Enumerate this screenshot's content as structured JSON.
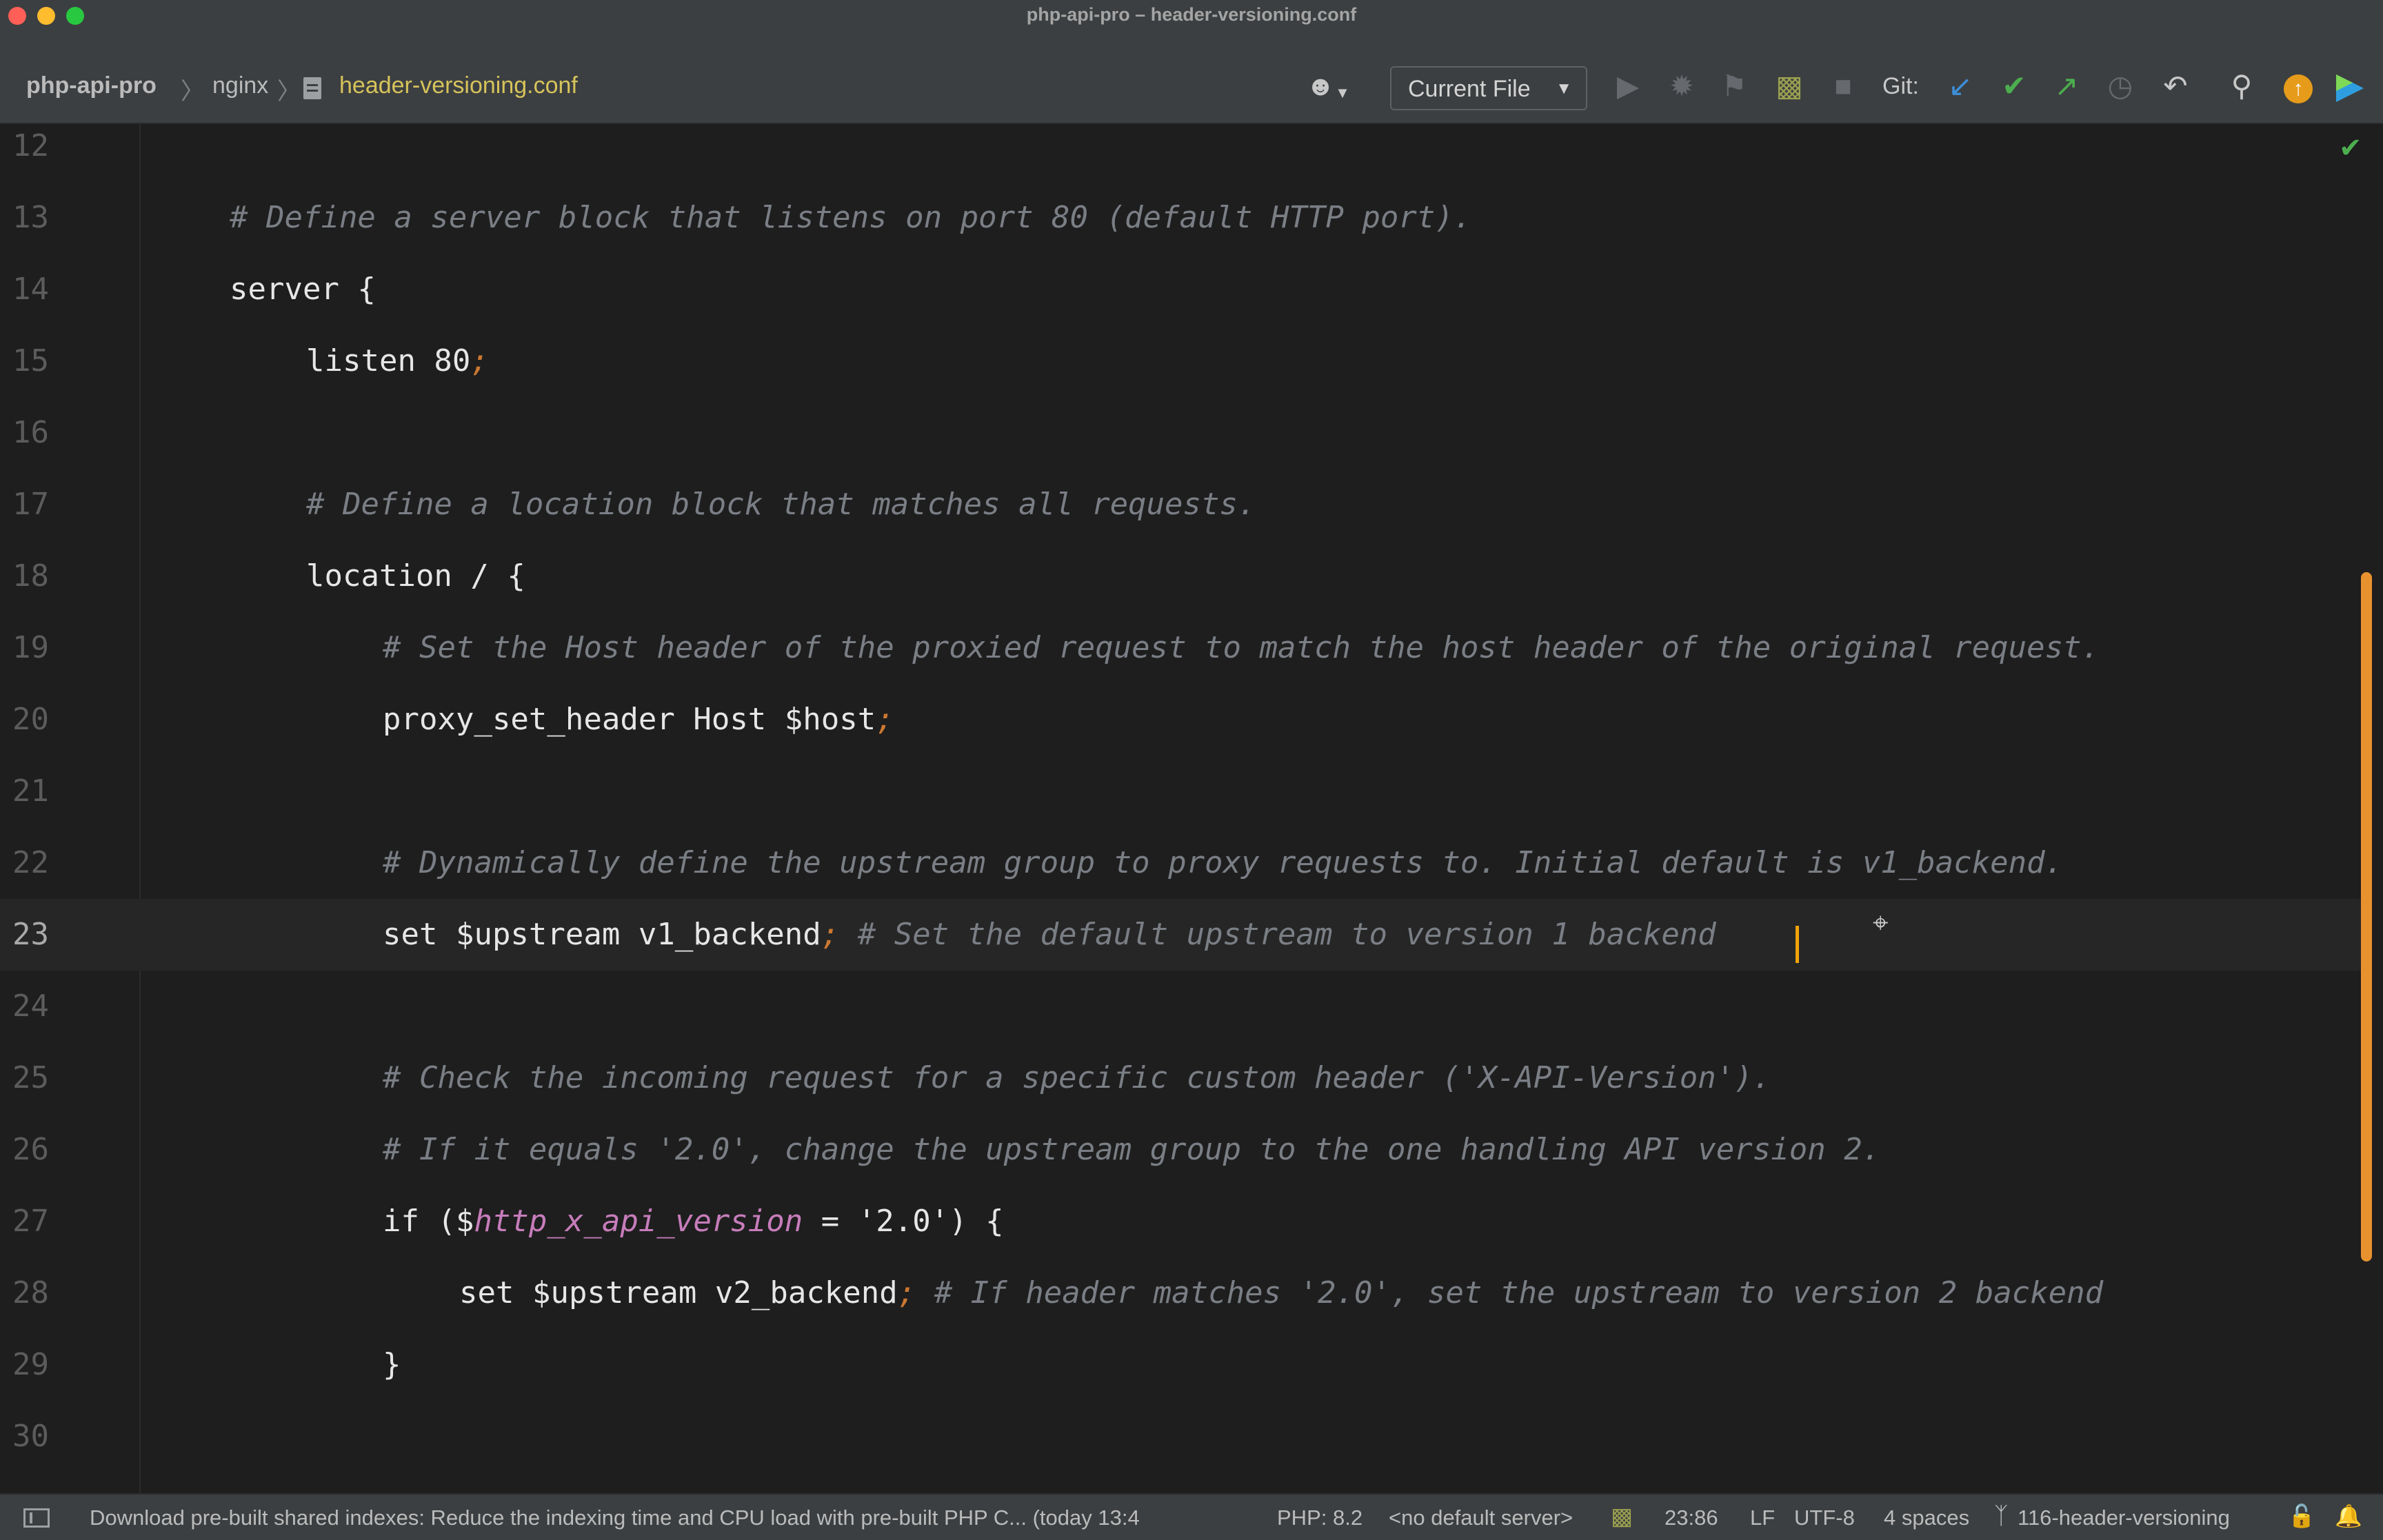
{
  "window": {
    "title": "php-api-pro – header-versioning.conf"
  },
  "navbar": {
    "breadcrumbs": [
      "php-api-pro",
      "nginx",
      "header-versioning.conf"
    ],
    "separator": "〉",
    "run_config": "Current File",
    "git_label": "Git:"
  },
  "editor": {
    "current_line": 23,
    "lines": [
      {
        "n": "12",
        "indent": 0,
        "tokens": []
      },
      {
        "n": "13",
        "indent": 1,
        "tokens": [
          {
            "t": "# Define a server block that listens on port 80 (default HTTP port).",
            "c": "cmt"
          }
        ]
      },
      {
        "n": "14",
        "indent": 1,
        "tokens": [
          {
            "t": "server {",
            "c": "kw"
          }
        ]
      },
      {
        "n": "15",
        "indent": 2,
        "tokens": [
          {
            "t": "listen 80",
            "c": "kw"
          },
          {
            "t": ";",
            "c": "punct"
          }
        ]
      },
      {
        "n": "16",
        "indent": 0,
        "tokens": []
      },
      {
        "n": "17",
        "indent": 2,
        "tokens": [
          {
            "t": "# Define a location block that matches all requests.",
            "c": "cmt"
          }
        ]
      },
      {
        "n": "18",
        "indent": 2,
        "tokens": [
          {
            "t": "location / {",
            "c": "kw"
          }
        ]
      },
      {
        "n": "19",
        "indent": 3,
        "tokens": [
          {
            "t": "# Set the Host header of the proxied request to match the host header of the original request.",
            "c": "cmt"
          }
        ]
      },
      {
        "n": "20",
        "indent": 3,
        "tokens": [
          {
            "t": "proxy_set_header Host $host",
            "c": "kw"
          },
          {
            "t": ";",
            "c": "punct"
          }
        ]
      },
      {
        "n": "21",
        "indent": 0,
        "tokens": []
      },
      {
        "n": "22",
        "indent": 3,
        "tokens": [
          {
            "t": "# Dynamically define the upstream group to proxy requests to. Initial default is v1_backend.",
            "c": "cmt"
          }
        ]
      },
      {
        "n": "23",
        "indent": 3,
        "tokens": [
          {
            "t": "set $upstream v1_backend",
            "c": "kw"
          },
          {
            "t": ";",
            "c": "punct"
          },
          {
            "t": " # Set the default upstream to version 1 backend",
            "c": "cmt"
          }
        ]
      },
      {
        "n": "24",
        "indent": 0,
        "tokens": []
      },
      {
        "n": "25",
        "indent": 3,
        "tokens": [
          {
            "t": "# Check the incoming request for a specific custom header ('X-API-Version').",
            "c": "cmt"
          }
        ]
      },
      {
        "n": "26",
        "indent": 3,
        "tokens": [
          {
            "t": "# If it equals '2.0', change the upstream group to the one handling API version 2.",
            "c": "cmt"
          }
        ]
      },
      {
        "n": "27",
        "indent": 3,
        "tokens": [
          {
            "t": "if ($",
            "c": "kw"
          },
          {
            "t": "http_x_api_version",
            "c": "var"
          },
          {
            "t": " = '2.0') {",
            "c": "kw"
          }
        ]
      },
      {
        "n": "28",
        "indent": 4,
        "tokens": [
          {
            "t": "set $upstream v2_backend",
            "c": "kw"
          },
          {
            "t": ";",
            "c": "punct"
          },
          {
            "t": " # If header matches '2.0', set the upstream to version 2 backend",
            "c": "cmt"
          }
        ]
      },
      {
        "n": "29",
        "indent": 3,
        "tokens": [
          {
            "t": "}",
            "c": "kw"
          }
        ]
      },
      {
        "n": "30",
        "indent": 0,
        "tokens": []
      }
    ]
  },
  "statusbar": {
    "message": "Download pre-built shared indexes: Reduce the indexing time and CPU load with pre-built PHP C... (today 13:4",
    "php_version": "PHP: 8.2",
    "server": "<no default server>",
    "position": "23:86",
    "line_separator": "LF",
    "encoding": "UTF-8",
    "indent": "4 spaces",
    "branch": "116-header-versioning"
  },
  "colors": {
    "comment": "#7a7e85",
    "semicolon": "#cc7832",
    "variable": "#c77dbb",
    "caret": "#f0a30a",
    "scrollbar": "#e8922f",
    "file_name": "#d6c35b"
  },
  "icons": [
    "user-icon",
    "run-icon",
    "debug-icon",
    "coverage-icon",
    "profile-icon",
    "stop-icon",
    "git-update-icon",
    "git-commit-icon",
    "git-push-icon",
    "history-icon",
    "rollback-icon",
    "search-icon",
    "update-icon",
    "plugin-icon",
    "checkmark-icon",
    "branch-icon",
    "lock-icon",
    "bell-icon"
  ]
}
